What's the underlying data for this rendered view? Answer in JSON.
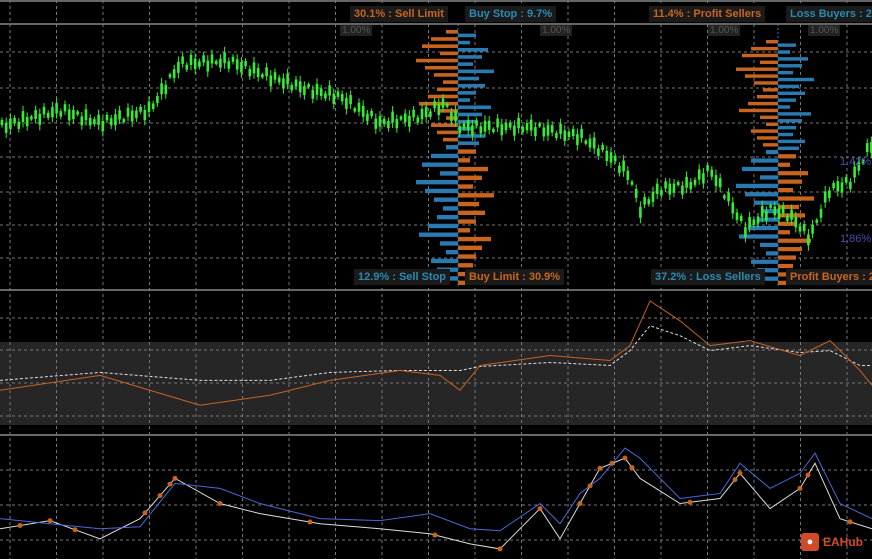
{
  "labels": {
    "sell_limit": "30.1% : Sell Limit",
    "buy_stop": "Buy Stop : 9.7%",
    "profit_sellers": "11.4% : Profit Sellers",
    "loss_buyers": "Loss Buyers : 2",
    "sell_stop": "12.9% : Sell Stop",
    "buy_limit": "Buy Limit : 30.9%",
    "loss_sellers": "37.2% : Loss Sellers",
    "profit_buyers": "Profit Buyers : 2",
    "pct_1": "1.00%",
    "pct_2": "1.00%",
    "pct_3": "1.00%",
    "pct_4": "1.00%",
    "level_high": "1.42%",
    "level_low": "1.86%"
  },
  "logo": {
    "text": "EAHub"
  },
  "colors": {
    "candle": "#33ee33",
    "orange": "#c8641e",
    "blue": "#2a7ab0",
    "indigo": "#4a6ad8"
  },
  "chart_data": [
    {
      "type": "line",
      "title": "Price (candlesticks)",
      "x": [
        0,
        60,
        100,
        150,
        180,
        230,
        270,
        310,
        340,
        380,
        420,
        445,
        460,
        530,
        580,
        610,
        630,
        640,
        660,
        690,
        710,
        730,
        745,
        770,
        790,
        810,
        830,
        850,
        872
      ],
      "values": [
        122,
        135,
        125,
        135,
        170,
        172,
        160,
        150,
        145,
        125,
        130,
        140,
        122,
        122,
        115,
        100,
        85,
        60,
        75,
        78,
        90,
        65,
        45,
        60,
        55,
        38,
        75,
        80,
        110
      ],
      "ylim": [
        0,
        200
      ]
    },
    {
      "type": "line",
      "title": "Oscillator 1",
      "x": [
        0,
        100,
        200,
        270,
        330,
        400,
        440,
        460,
        480,
        550,
        610,
        630,
        650,
        680,
        710,
        750,
        800,
        830,
        860,
        872
      ],
      "series": [
        {
          "name": "orange",
          "values": [
            42,
            57,
            27,
            37,
            52,
            62,
            57,
            42,
            67,
            77,
            72,
            87,
            132,
            112,
            87,
            92,
            77,
            92,
            62,
            47
          ]
        },
        {
          "name": "white-dashed",
          "values": [
            52,
            60,
            52,
            52,
            60,
            62,
            62,
            62,
            66,
            70,
            67,
            82,
            107,
            97,
            82,
            87,
            80,
            82,
            67,
            67
          ]
        }
      ],
      "ylim": [
        0,
        140
      ]
    },
    {
      "type": "line",
      "title": "Oscillator 2",
      "x": [
        0,
        50,
        100,
        140,
        175,
        220,
        260,
        320,
        380,
        430,
        470,
        500,
        540,
        560,
        580,
        600,
        625,
        640,
        680,
        720,
        740,
        770,
        800,
        815,
        840,
        872
      ],
      "series": [
        {
          "name": "blue",
          "values": [
            40,
            35,
            30,
            32,
            75,
            70,
            55,
            40,
            38,
            45,
            30,
            28,
            55,
            35,
            65,
            80,
            110,
            100,
            60,
            65,
            95,
            70,
            85,
            105,
            55,
            40
          ]
        },
        {
          "name": "white",
          "values": [
            30,
            38,
            20,
            40,
            80,
            55,
            45,
            35,
            30,
            25,
            15,
            10,
            50,
            20,
            55,
            90,
            100,
            80,
            55,
            60,
            85,
            50,
            70,
            95,
            40,
            30
          ]
        }
      ],
      "markers_x": [
        20,
        50,
        75,
        145,
        160,
        170,
        175,
        220,
        310,
        435,
        500,
        540,
        580,
        590,
        600,
        612,
        625,
        632,
        690,
        735,
        740,
        800,
        808,
        850
      ],
      "ylim": [
        0,
        120
      ]
    },
    {
      "type": "bar",
      "title": "Order book histograms",
      "series": [
        {
          "name": "sell-side",
          "values": [
            20,
            45,
            60,
            30,
            70,
            55,
            40,
            25,
            35,
            50,
            65,
            30,
            20,
            45,
            35,
            25
          ]
        },
        {
          "name": "buy-side",
          "values": [
            30,
            20,
            50,
            40,
            25,
            60,
            35,
            45,
            30,
            20,
            55,
            40,
            30,
            25,
            45,
            35
          ]
        }
      ]
    }
  ]
}
